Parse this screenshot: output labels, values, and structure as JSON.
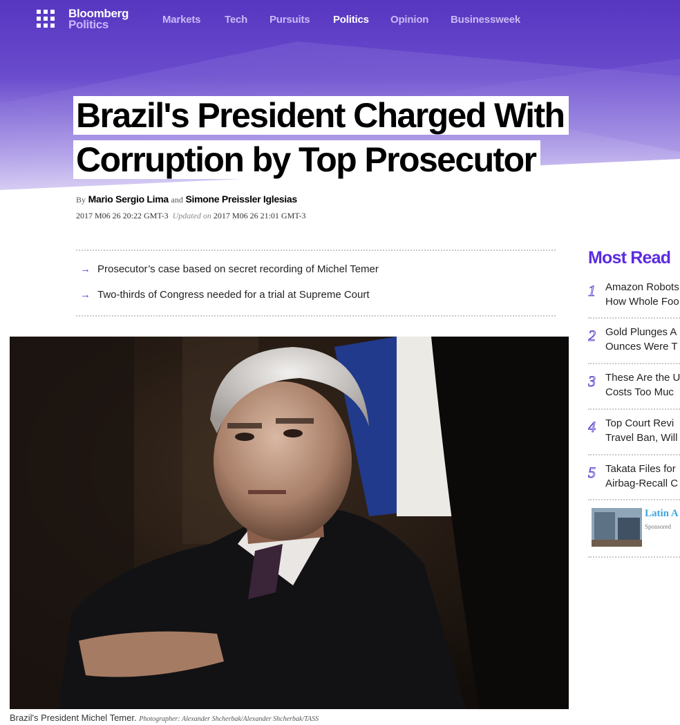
{
  "brand": {
    "name": "Bloomberg",
    "section": "Politics"
  },
  "nav": {
    "items": [
      {
        "label": "Markets"
      },
      {
        "label": "Tech"
      },
      {
        "label": "Pursuits"
      },
      {
        "label": "Politics",
        "active": true
      },
      {
        "label": "Opinion"
      },
      {
        "label": "Businessweek"
      }
    ]
  },
  "article": {
    "headline_line1": "Brazil's President Charged With",
    "headline_line2": "Corruption by Top Prosecutor",
    "by_prefix": "By",
    "author1": "Mario Sergio Lima",
    "and": "and",
    "author2": "Simone Preissler Iglesias",
    "published": "2017 M06 26 20:22 GMT-3",
    "updated_label": "Updated on",
    "updated": "2017 M06 26 21:01 GMT-3",
    "bullets": [
      "Prosecutor’s case based on secret recording of Michel Temer",
      "Two-thirds of Congress needed for a trial at Supreme Court"
    ],
    "caption": "Brazil's President Michel Temer.",
    "credit": "Photographer: Alexander Shcherbak/Alexander Shcherbak/TASS"
  },
  "most_read": {
    "title": "Most Read",
    "items": [
      {
        "num": "1",
        "line1": "Amazon Robots",
        "line2": "How Whole Foo"
      },
      {
        "num": "2",
        "line1": "Gold Plunges A",
        "line2": "Ounces Were T"
      },
      {
        "num": "3",
        "line1": "These Are the U",
        "line2": "Costs Too Muc"
      },
      {
        "num": "4",
        "line1": "Top Court Revi",
        "line2": "Travel Ban, Will"
      },
      {
        "num": "5",
        "line1": "Takata Files for",
        "line2": "Airbag-Recall C"
      }
    ],
    "sponsored": {
      "title": "Latin A",
      "label": "Sponsored"
    }
  },
  "colors": {
    "brand_purple": "#5b2be0",
    "band_top": "#5a3cc2",
    "sponsored_link": "#3fa6dc"
  }
}
